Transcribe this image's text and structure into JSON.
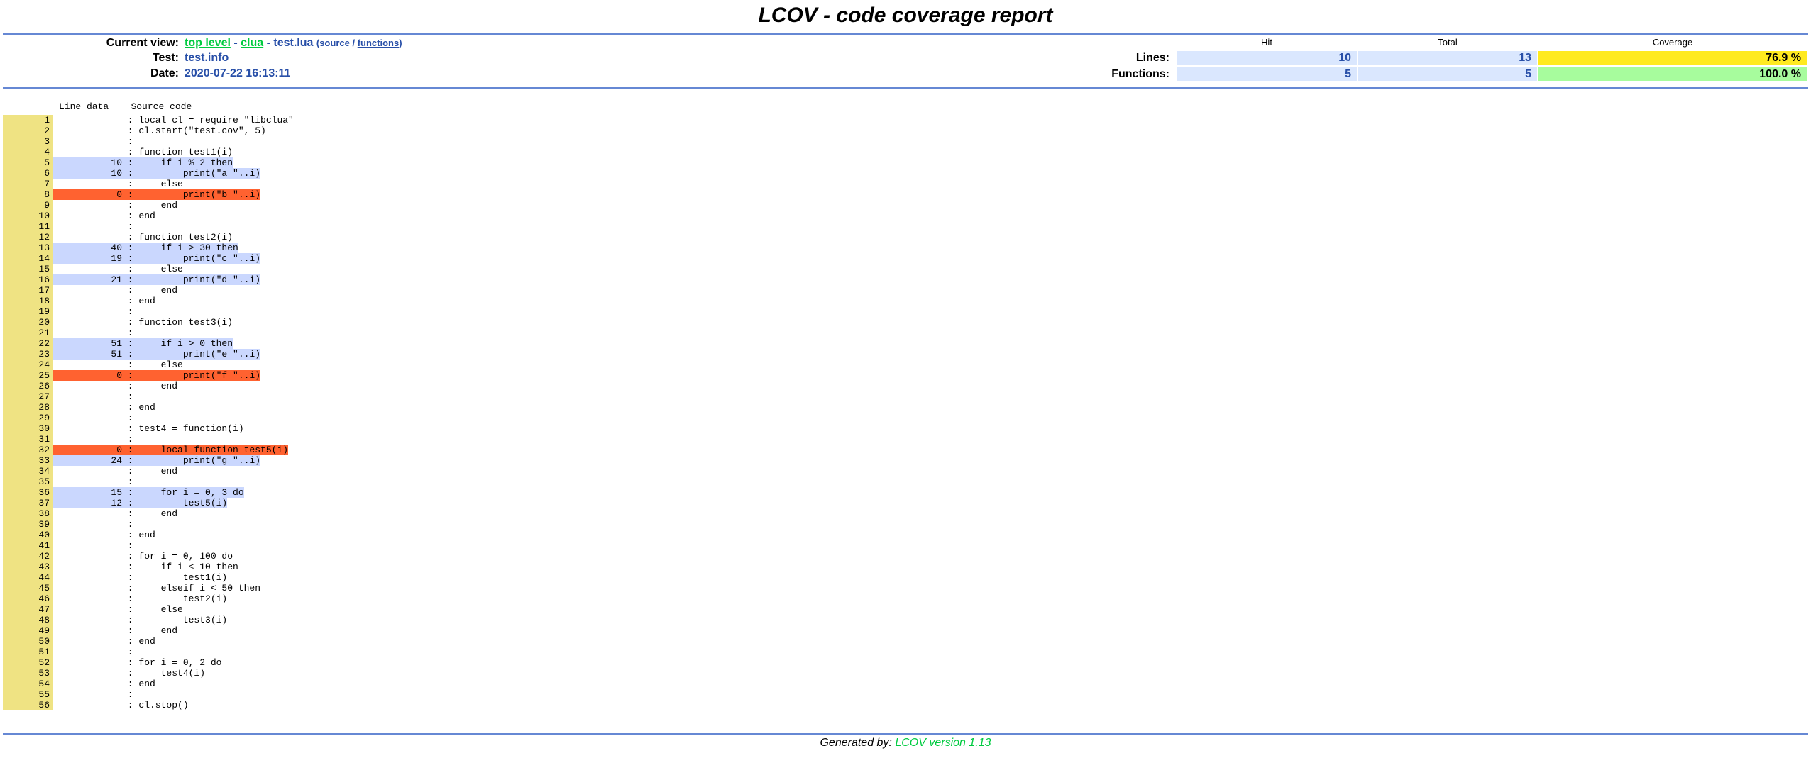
{
  "title": "LCOV - code coverage report",
  "header": {
    "current_view_label": "Current view:",
    "top_level": "top level",
    "sep1": "-",
    "clua": "clua",
    "sep2": "-",
    "file": "test.lua",
    "source_link": "source",
    "slash": "/",
    "functions_link": "functions",
    "test_label": "Test:",
    "test_value": "test.info",
    "date_label": "Date:",
    "date_value": "2020-07-22 16:13:11"
  },
  "summary": {
    "hit_head": "Hit",
    "total_head": "Total",
    "coverage_head": "Coverage",
    "lines_label": "Lines:",
    "lines_hit": "10",
    "lines_total": "13",
    "lines_coverage": "76.9 %",
    "functions_label": "Functions:",
    "functions_hit": "5",
    "functions_total": "5",
    "functions_coverage": "100.0 %"
  },
  "source_header": {
    "line_data": "Line data",
    "source_code": "Source code"
  },
  "lines": [
    {
      "n": "1",
      "count": "",
      "status": "plain",
      "code": "local cl = require \"libclua\""
    },
    {
      "n": "2",
      "count": "",
      "status": "plain",
      "code": "cl.start(\"test.cov\", 5)"
    },
    {
      "n": "3",
      "count": "",
      "status": "plain",
      "code": ""
    },
    {
      "n": "4",
      "count": "",
      "status": "plain",
      "code": "function test1(i)"
    },
    {
      "n": "5",
      "count": "10",
      "status": "hit",
      "code": "    if i % 2 then"
    },
    {
      "n": "6",
      "count": "10",
      "status": "hit",
      "code": "        print(\"a \"..i)"
    },
    {
      "n": "7",
      "count": "",
      "status": "plain",
      "code": "    else"
    },
    {
      "n": "8",
      "count": "0",
      "status": "miss",
      "code": "        print(\"b \"..i)"
    },
    {
      "n": "9",
      "count": "",
      "status": "plain",
      "code": "    end"
    },
    {
      "n": "10",
      "count": "",
      "status": "plain",
      "code": "end"
    },
    {
      "n": "11",
      "count": "",
      "status": "plain",
      "code": ""
    },
    {
      "n": "12",
      "count": "",
      "status": "plain",
      "code": "function test2(i)"
    },
    {
      "n": "13",
      "count": "40",
      "status": "hit",
      "code": "    if i > 30 then"
    },
    {
      "n": "14",
      "count": "19",
      "status": "hit",
      "code": "        print(\"c \"..i)"
    },
    {
      "n": "15",
      "count": "",
      "status": "plain",
      "code": "    else"
    },
    {
      "n": "16",
      "count": "21",
      "status": "hit",
      "code": "        print(\"d \"..i)"
    },
    {
      "n": "17",
      "count": "",
      "status": "plain",
      "code": "    end"
    },
    {
      "n": "18",
      "count": "",
      "status": "plain",
      "code": "end"
    },
    {
      "n": "19",
      "count": "",
      "status": "plain",
      "code": ""
    },
    {
      "n": "20",
      "count": "",
      "status": "plain",
      "code": "function test3(i)"
    },
    {
      "n": "21",
      "count": "",
      "status": "plain",
      "code": ""
    },
    {
      "n": "22",
      "count": "51",
      "status": "hit",
      "code": "    if i > 0 then"
    },
    {
      "n": "23",
      "count": "51",
      "status": "hit",
      "code": "        print(\"e \"..i)"
    },
    {
      "n": "24",
      "count": "",
      "status": "plain",
      "code": "    else"
    },
    {
      "n": "25",
      "count": "0",
      "status": "miss",
      "code": "        print(\"f \"..i)"
    },
    {
      "n": "26",
      "count": "",
      "status": "plain",
      "code": "    end"
    },
    {
      "n": "27",
      "count": "",
      "status": "plain",
      "code": ""
    },
    {
      "n": "28",
      "count": "",
      "status": "plain",
      "code": "end"
    },
    {
      "n": "29",
      "count": "",
      "status": "plain",
      "code": ""
    },
    {
      "n": "30",
      "count": "",
      "status": "plain",
      "code": "test4 = function(i)"
    },
    {
      "n": "31",
      "count": "",
      "status": "plain",
      "code": ""
    },
    {
      "n": "32",
      "count": "0",
      "status": "miss",
      "code": "    local function test5(i)"
    },
    {
      "n": "33",
      "count": "24",
      "status": "hit",
      "code": "        print(\"g \"..i)"
    },
    {
      "n": "34",
      "count": "",
      "status": "plain",
      "code": "    end"
    },
    {
      "n": "35",
      "count": "",
      "status": "plain",
      "code": ""
    },
    {
      "n": "36",
      "count": "15",
      "status": "hit",
      "code": "    for i = 0, 3 do"
    },
    {
      "n": "37",
      "count": "12",
      "status": "hit",
      "code": "        test5(i)"
    },
    {
      "n": "38",
      "count": "",
      "status": "plain",
      "code": "    end"
    },
    {
      "n": "39",
      "count": "",
      "status": "plain",
      "code": ""
    },
    {
      "n": "40",
      "count": "",
      "status": "plain",
      "code": "end"
    },
    {
      "n": "41",
      "count": "",
      "status": "plain",
      "code": ""
    },
    {
      "n": "42",
      "count": "",
      "status": "plain",
      "code": "for i = 0, 100 do"
    },
    {
      "n": "43",
      "count": "",
      "status": "plain",
      "code": "    if i < 10 then"
    },
    {
      "n": "44",
      "count": "",
      "status": "plain",
      "code": "        test1(i)"
    },
    {
      "n": "45",
      "count": "",
      "status": "plain",
      "code": "    elseif i < 50 then"
    },
    {
      "n": "46",
      "count": "",
      "status": "plain",
      "code": "        test2(i)"
    },
    {
      "n": "47",
      "count": "",
      "status": "plain",
      "code": "    else"
    },
    {
      "n": "48",
      "count": "",
      "status": "plain",
      "code": "        test3(i)"
    },
    {
      "n": "49",
      "count": "",
      "status": "plain",
      "code": "    end"
    },
    {
      "n": "50",
      "count": "",
      "status": "plain",
      "code": "end"
    },
    {
      "n": "51",
      "count": "",
      "status": "plain",
      "code": ""
    },
    {
      "n": "52",
      "count": "",
      "status": "plain",
      "code": "for i = 0, 2 do"
    },
    {
      "n": "53",
      "count": "",
      "status": "plain",
      "code": "    test4(i)"
    },
    {
      "n": "54",
      "count": "",
      "status": "plain",
      "code": "end"
    },
    {
      "n": "55",
      "count": "",
      "status": "plain",
      "code": ""
    },
    {
      "n": "56",
      "count": "",
      "status": "plain",
      "code": "cl.stop()"
    }
  ],
  "footer": {
    "prefix": "Generated by: ",
    "link": "LCOV version 1.13"
  },
  "colors": {
    "rule": "#6688d4",
    "hit": "#cad7fe",
    "miss": "#ff6230",
    "lineno": "#efe383",
    "coverage_medium": "#ffea20",
    "coverage_high": "#a7fc9d",
    "link": "#00cb40"
  }
}
